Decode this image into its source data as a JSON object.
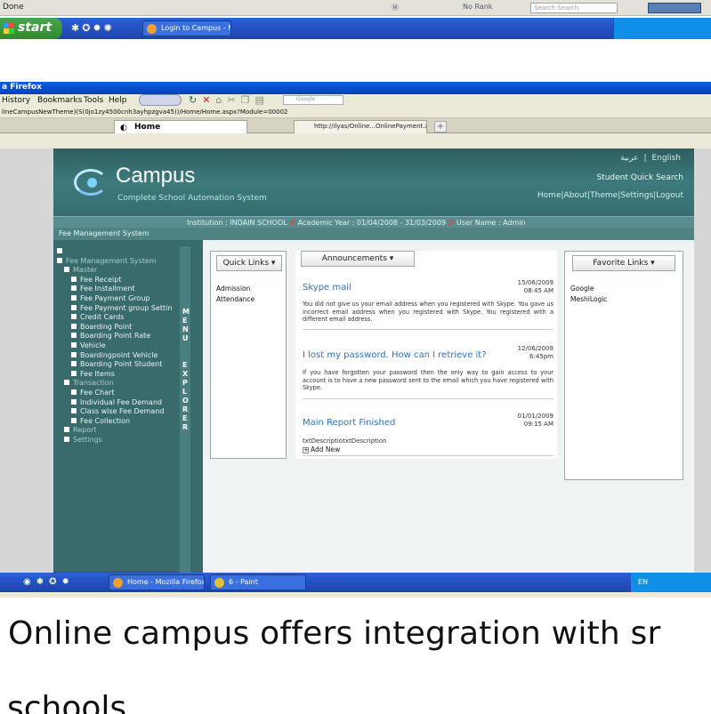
{
  "top_strip": {
    "status_text": "Done",
    "toolbar_items": [
      "Ⓜ",
      "No Rank",
      "Search Search"
    ],
    "search_placeholder": "Search Search",
    "start_label": "start",
    "task_label": "Login to Campus - M..."
  },
  "browser": {
    "window_title": "a Firefox",
    "menu": [
      "History",
      "Bookmarks",
      "Tools",
      "Help"
    ],
    "search_placeholder": "Google",
    "url": "lineCampusNewTheme)(S(0jo1zy4500cnh3ayhpzgva45))/Home/Home.aspx?Module=00002",
    "tabs": [
      {
        "label": "Home"
      },
      {
        "label": "http://ilyas/Online...OnlinePayment.aspx"
      }
    ]
  },
  "header": {
    "app_name": "Campus",
    "tagline": "Complete School Automation System",
    "languages": [
      "عربية",
      "|",
      "English"
    ],
    "student_quick_search": "Student Quick Search",
    "top_links": "Home|About|Theme|Settings|Logout"
  },
  "infobar": {
    "institution": "Institution : INDAIN SCHOOL",
    "academic_year": "Academic Year : 01/04/2008 - 31/03/2009",
    "user_name": "User Name : Admin",
    "separator": "//"
  },
  "fms_bar": "Fee Management System",
  "sidebar": {
    "tree": [
      {
        "label": "Fee Management System",
        "level": 1
      },
      {
        "label": "Master",
        "level": 2
      },
      {
        "label": "Fee Receipt",
        "level": 3
      },
      {
        "label": "Fee Installment",
        "level": 3
      },
      {
        "label": "Fee Payment Group",
        "level": 3
      },
      {
        "label": "Fee Payment group Settin",
        "level": 3
      },
      {
        "label": "Credit Cards",
        "level": 3
      },
      {
        "label": "Boarding Point",
        "level": 3
      },
      {
        "label": "Boarding Point Rate",
        "level": 3
      },
      {
        "label": "Vehicle",
        "level": 3
      },
      {
        "label": "Boardingpoint Vehicle",
        "level": 3
      },
      {
        "label": "Boarding Point Student",
        "level": 3
      },
      {
        "label": "Fee Items",
        "level": 3
      },
      {
        "label": "Transaction",
        "level": 2
      },
      {
        "label": "Fee Chart",
        "level": 3
      },
      {
        "label": "Individual Fee Demand",
        "level": 3
      },
      {
        "label": "Class wise Fee Demand",
        "level": 3
      },
      {
        "label": "Fee Collection",
        "level": 3
      },
      {
        "label": "Report",
        "level": 2
      },
      {
        "label": "Settings",
        "level": 2
      }
    ],
    "menu_word": [
      "M",
      "E",
      "N",
      "U"
    ],
    "explorer_word": [
      "E",
      "X",
      "P",
      "L",
      "O",
      "R",
      "E",
      "R"
    ]
  },
  "quick_links": {
    "header": "Quick Links ▾",
    "items": [
      "Admission",
      "Attendance"
    ]
  },
  "favorite_links": {
    "header": "Favorite Links ▾",
    "items": [
      "Google",
      "MeshiLogic"
    ]
  },
  "announcements": {
    "header": "Announcements ▾",
    "items": [
      {
        "title": "Skype mail",
        "date": "15/06/2009",
        "time": "08:45 AM",
        "body": "You did not give us your email address when you registered with Skype. You gave us incorrect email address when you registered with Skype. You registered with a different email address."
      },
      {
        "title": "I lost my password. How can I retrieve it?",
        "date": "12/06/2009",
        "time": "6:45pm",
        "body": "If you have forgotten your password then the only way to gain access to your account is to have a new password sent to the email which you have registered with Skype."
      },
      {
        "title": "Main Report Finished",
        "date": "01/01/2009",
        "time": "09:15 AM",
        "body": "txtDescriptiotxtDescription"
      }
    ],
    "add_new": "Add New"
  },
  "bottom_taskbar": {
    "tasks": [
      "Home - Mozilla Firefox",
      "6 - Paint"
    ],
    "tray_lang": "EN"
  },
  "caption": {
    "line1": "Online campus offers integration with sr",
    "line2": "schools"
  }
}
